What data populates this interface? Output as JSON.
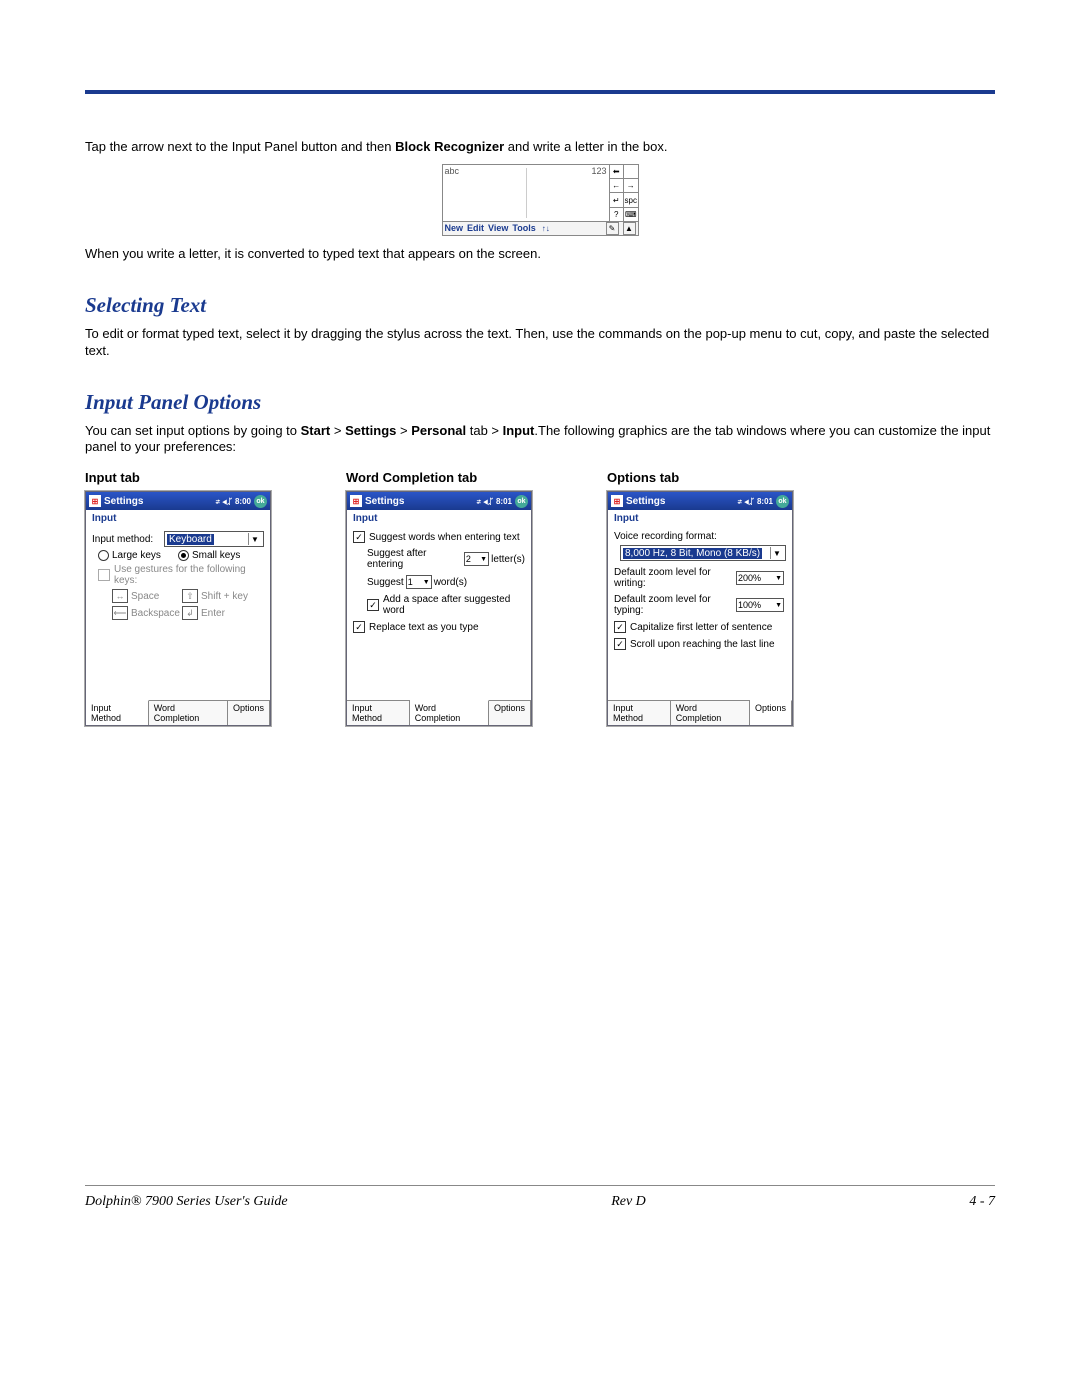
{
  "intro": {
    "line1a": "Tap the arrow next to the Input Panel button and then ",
    "line1b": "Block Recognizer",
    "line1c": " and write a letter in the box.",
    "line2": "When you write a letter, it is converted to typed text that appears on the screen."
  },
  "blockrec": {
    "abc": "abc",
    "n123": "123",
    "side": {
      "r1c1": "⬅",
      "r2c1": "←",
      "r2c2": "→",
      "r3c1": "↵",
      "r3c2": "spc",
      "r4c1": "?",
      "r4c2": "⌨"
    },
    "menu": {
      "new": "New",
      "edit": "Edit",
      "view": "View",
      "tools": "Tools"
    },
    "updown": "↑↓",
    "pen": "✎",
    "tri": "▲"
  },
  "sec1": {
    "heading": "Selecting Text",
    "body": "To edit or format typed text, select it by dragging the stylus across the text. Then, use the commands on the pop-up menu to cut, copy, and paste the selected text."
  },
  "sec2": {
    "heading": "Input Panel Options",
    "body_a": "You can set input options by going to ",
    "body_b1": "Start",
    "gt1": " > ",
    "body_b2": "Settings",
    "gt2": " > ",
    "body_b3": "Personal",
    "tab_word": " tab > ",
    "body_b4": "Input",
    "body_c": ".The following graphics are the tab windows where you can customize the input panel to your preferences:"
  },
  "columns": {
    "input": {
      "title": "Input tab"
    },
    "wordc": {
      "title": "Word Completion tab"
    },
    "options": {
      "title": "Options tab"
    }
  },
  "wince_common": {
    "title": "Settings",
    "subtitle": "Input",
    "ok": "ok",
    "tabs": {
      "t1": "Input Method",
      "t2": "Word Completion",
      "t3": "Options"
    }
  },
  "input_tab": {
    "time": "8:00",
    "input_method_label": "Input method:",
    "input_method_value": "Keyboard",
    "large_keys": "Large keys",
    "small_keys": "Small keys",
    "use_gestures": "Use gestures for the following keys:",
    "g_space": "Space",
    "g_shift": "Shift + key",
    "g_back": "Backspace",
    "g_enter": "Enter"
  },
  "wordc_tab": {
    "time": "8:01",
    "suggest_words": "Suggest words when entering text",
    "suggest_after_a": "Suggest after entering",
    "suggest_after_val": "2",
    "suggest_after_b": "letter(s)",
    "suggest_n_a": "Suggest",
    "suggest_n_val": "1",
    "suggest_n_b": "word(s)",
    "add_space": "Add a space after suggested word",
    "replace": "Replace text as you type"
  },
  "options_tab": {
    "time": "8:01",
    "voice_label": "Voice recording format:",
    "voice_value": "8,000 Hz, 8 Bit, Mono (8 KB/s)",
    "zoom_write_label": "Default zoom level for writing:",
    "zoom_write_val": "200%",
    "zoom_type_label": "Default zoom level for typing:",
    "zoom_type_val": "100%",
    "capitalize": "Capitalize first letter of sentence",
    "scroll": "Scroll upon reaching the last line"
  },
  "footer": {
    "left": "Dolphin® 7900 Series User's Guide",
    "center": "Rev D",
    "right": "4 - 7"
  },
  "sig_glyph": "⇄ ◀ᛢ "
}
